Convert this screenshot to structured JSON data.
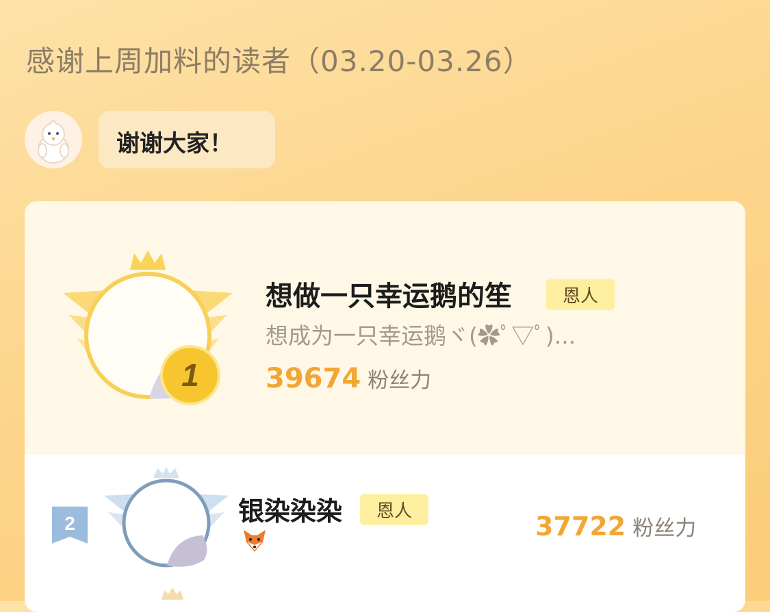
{
  "header": {
    "title": "感谢上周加料的读者（03.20-03.26）"
  },
  "mascot": {
    "message": "谢谢大家！"
  },
  "leaderboard": {
    "accent_color": "#f2a634",
    "entries": [
      {
        "rank": "1",
        "name": "想做一只幸运鹅的笙",
        "badge": "恩人",
        "bio": "想成为一只幸运鹅ヾ(✿ﾟ▽ﾟ)...",
        "score": "39674",
        "score_unit": "粉丝力"
      },
      {
        "rank": "2",
        "name": "银染染染",
        "badge": "恩人",
        "bio_icon": "fox-emoji",
        "score": "37722",
        "score_unit": "粉丝力"
      }
    ]
  }
}
